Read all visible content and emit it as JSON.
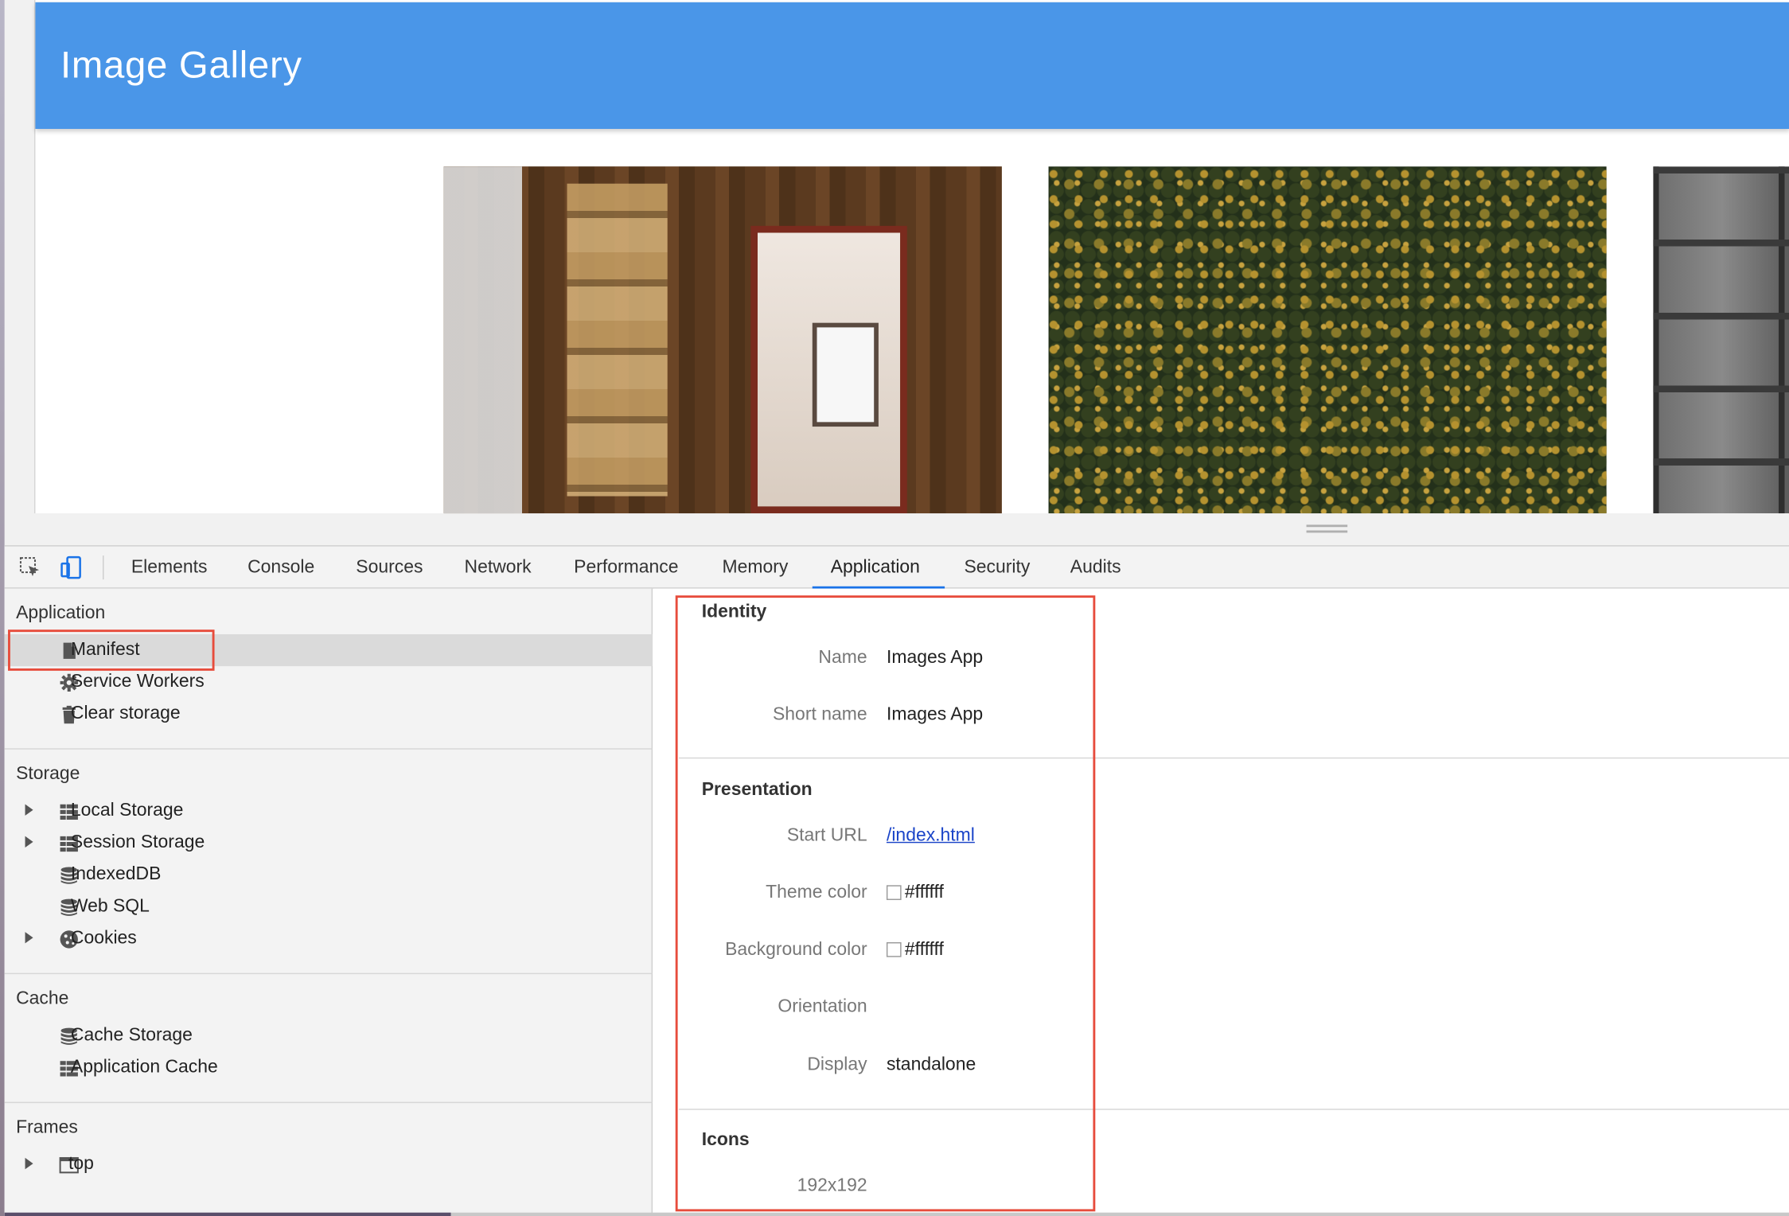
{
  "site": {
    "title": "Image Gallery",
    "photos": [
      "library-photo",
      "forest-photo",
      "brick-wall-photo"
    ]
  },
  "devtools": {
    "tabs": [
      "Elements",
      "Console",
      "Sources",
      "Network",
      "Performance",
      "Memory",
      "Application",
      "Security",
      "Audits"
    ],
    "active_tab": "Application",
    "sidebar": {
      "application_title": "Application",
      "application_items": [
        {
          "label": "Manifest",
          "icon": "file-icon",
          "selected": true
        },
        {
          "label": "Service Workers",
          "icon": "gear-icon"
        },
        {
          "label": "Clear storage",
          "icon": "trash-icon"
        }
      ],
      "storage_title": "Storage",
      "storage_items": [
        {
          "label": "Local Storage",
          "icon": "grid-icon",
          "expandable": true
        },
        {
          "label": "Session Storage",
          "icon": "grid-icon",
          "expandable": true
        },
        {
          "label": "IndexedDB",
          "icon": "database-icon"
        },
        {
          "label": "Web SQL",
          "icon": "database-icon"
        },
        {
          "label": "Cookies",
          "icon": "cookie-icon",
          "expandable": true
        }
      ],
      "cache_title": "Cache",
      "cache_items": [
        {
          "label": "Cache Storage",
          "icon": "database-icon"
        },
        {
          "label": "Application Cache",
          "icon": "grid-icon"
        }
      ],
      "frames_title": "Frames",
      "frames_items": [
        {
          "label": "top",
          "icon": "frame-icon",
          "expandable": true
        }
      ]
    },
    "manifest": {
      "identity_title": "Identity",
      "name_label": "Name",
      "name_value": "Images App",
      "short_name_label": "Short name",
      "short_name_value": "Images App",
      "presentation_title": "Presentation",
      "start_url_label": "Start URL",
      "start_url_value": "/index.html",
      "theme_color_label": "Theme color",
      "theme_color_value": "#ffffff",
      "background_color_label": "Background color",
      "background_color_value": "#ffffff",
      "orientation_label": "Orientation",
      "orientation_value": "",
      "display_label": "Display",
      "display_value": "standalone",
      "icons_title": "Icons",
      "icon_size_label": "192x192"
    }
  },
  "colors": {
    "header_blue": "#4a96e8",
    "highlight_red": "#e74c3c",
    "link_blue": "#1a44c8",
    "active_tab_underline": "#1a73e8"
  }
}
